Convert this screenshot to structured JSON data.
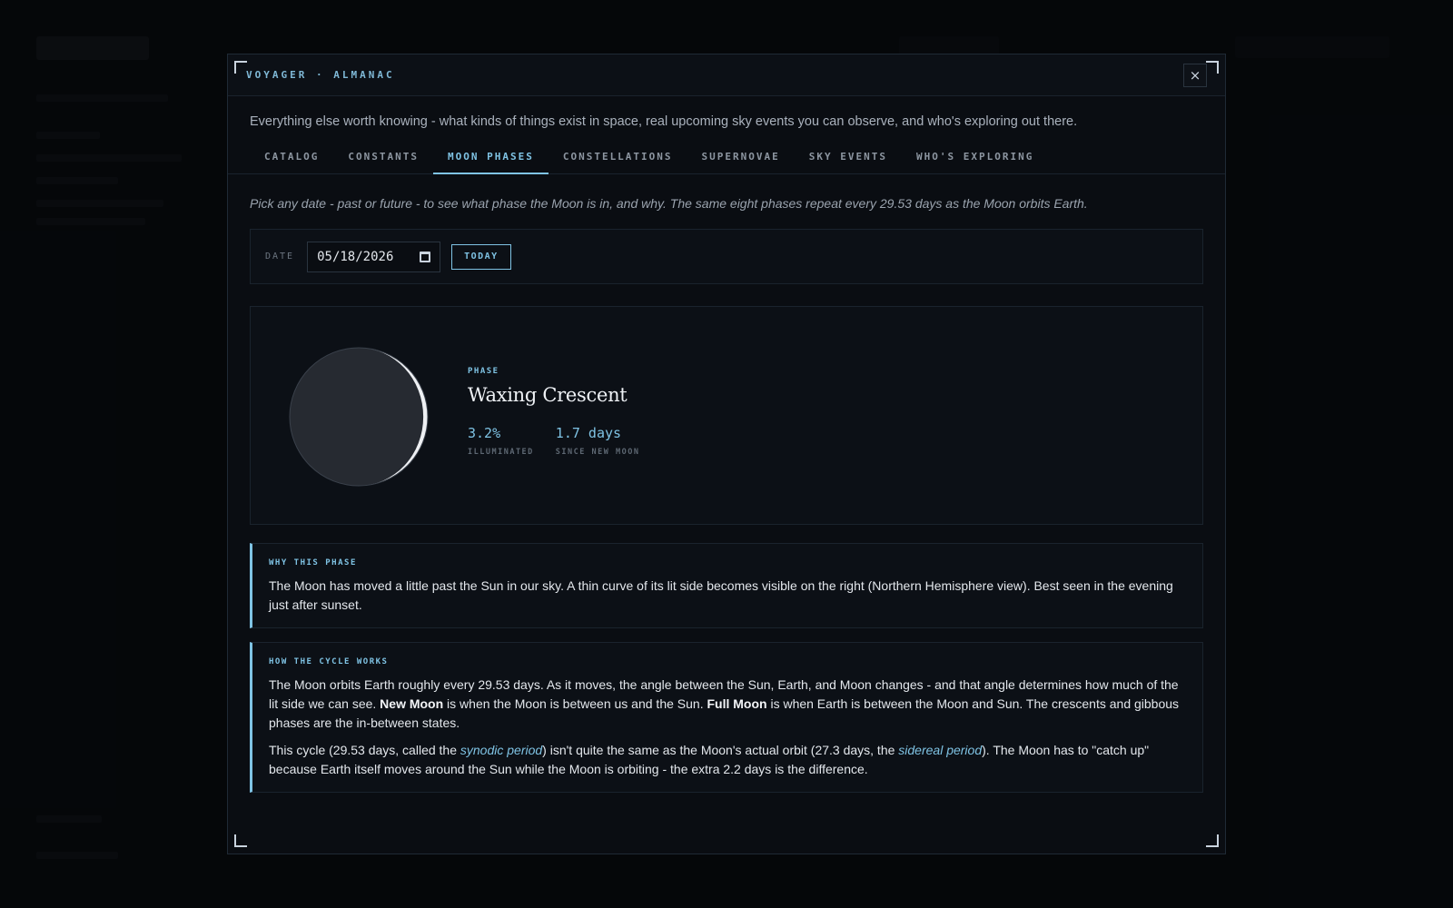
{
  "modal": {
    "brand": "VOYAGER · ALMANAC",
    "close_label": "×",
    "intro": "Everything else worth knowing - what kinds of things exist in space, real upcoming sky events you can observe, and who's exploring out there."
  },
  "tabs": [
    {
      "label": "CATALOG",
      "active": false
    },
    {
      "label": "CONSTANTS",
      "active": false
    },
    {
      "label": "MOON PHASES",
      "active": true
    },
    {
      "label": "CONSTELLATIONS",
      "active": false
    },
    {
      "label": "SUPERNOVAE",
      "active": false
    },
    {
      "label": "SKY EVENTS",
      "active": false
    },
    {
      "label": "WHO'S EXPLORING",
      "active": false
    }
  ],
  "moon_phases": {
    "description": "Pick any date - past or future - to see what phase the Moon is in, and why. The same eight phases repeat every 29.53 days as the Moon orbits Earth.",
    "date_label": "DATE",
    "date_value": "05/18/2026",
    "today_button": "TODAY",
    "phase_label": "PHASE",
    "phase_name": "Waxing Crescent",
    "illumination_fraction": 0.032,
    "illuminated_value": "3.2%",
    "illuminated_label": "ILLUMINATED",
    "age_value": "1.7 days",
    "age_label": "SINCE NEW MOON",
    "why_title": "WHY THIS PHASE",
    "why_text": "The Moon has moved a little past the Sun in our sky. A thin curve of its lit side becomes visible on the right (Northern Hemisphere view). Best seen in the evening just after sunset.",
    "cycle_title": "HOW THE CYCLE WORKS",
    "cycle_p1_a": "The Moon orbits Earth roughly every 29.53 days. As it moves, the angle between the Sun, Earth, and Moon changes - and that angle determines how much of the lit side we can see. ",
    "cycle_p1_new": "New Moon",
    "cycle_p1_b": " is when the Moon is between us and the Sun. ",
    "cycle_p1_full": "Full Moon",
    "cycle_p1_c": " is when Earth is between the Moon and Sun. The crescents and gibbous phases are the in-between states.",
    "cycle_p2_a": "This cycle (29.53 days, called the ",
    "cycle_p2_synodic": "synodic period",
    "cycle_p2_b": ") isn't quite the same as the Moon's actual orbit (27.3 days, the ",
    "cycle_p2_sidereal": "sidereal period",
    "cycle_p2_c": "). The Moon has to \"catch up\" because Earth itself moves around the Sun while the Moon is orbiting - the extra 2.2 days is the difference."
  },
  "colors": {
    "accent": "#7fc3e4",
    "moon_dark": "#262a31",
    "moon_lit": "#eef0f3"
  },
  "icons": {
    "close": "close-icon",
    "calendar": "calendar-icon"
  }
}
